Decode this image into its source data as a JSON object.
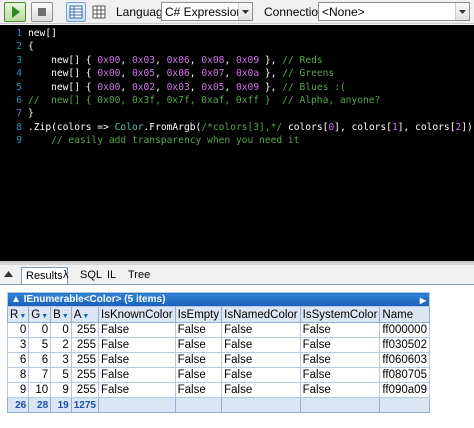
{
  "toolbar": {
    "language_label": "Language",
    "language_value": "C# Expression",
    "connection_label": "Connection",
    "connection_value": "<None>"
  },
  "editor": {
    "line_numbers": [
      "1",
      "2",
      "3",
      "4",
      "5",
      "6",
      "7",
      "8",
      "9"
    ]
  },
  "tabs": {
    "results": "Results",
    "lambda": "λ",
    "sql": "SQL",
    "il": "IL",
    "tree": "Tree"
  },
  "results": {
    "caption": "IEnumerable<Color> (5 items)",
    "columns": [
      "R",
      "G",
      "B",
      "A",
      "IsKnownColor",
      "IsEmpty",
      "IsNamedColor",
      "IsSystemColor",
      "Name"
    ],
    "rows": [
      [
        "0",
        "0",
        "0",
        "255",
        "False",
        "False",
        "False",
        "False",
        "ff000000"
      ],
      [
        "3",
        "5",
        "2",
        "255",
        "False",
        "False",
        "False",
        "False",
        "ff030502"
      ],
      [
        "6",
        "6",
        "3",
        "255",
        "False",
        "False",
        "False",
        "False",
        "ff060603"
      ],
      [
        "8",
        "7",
        "5",
        "255",
        "False",
        "False",
        "False",
        "False",
        "ff080705"
      ],
      [
        "9",
        "10",
        "9",
        "255",
        "False",
        "False",
        "False",
        "False",
        "ff090a09"
      ]
    ],
    "totals": [
      "26",
      "28",
      "19",
      "1275"
    ]
  }
}
